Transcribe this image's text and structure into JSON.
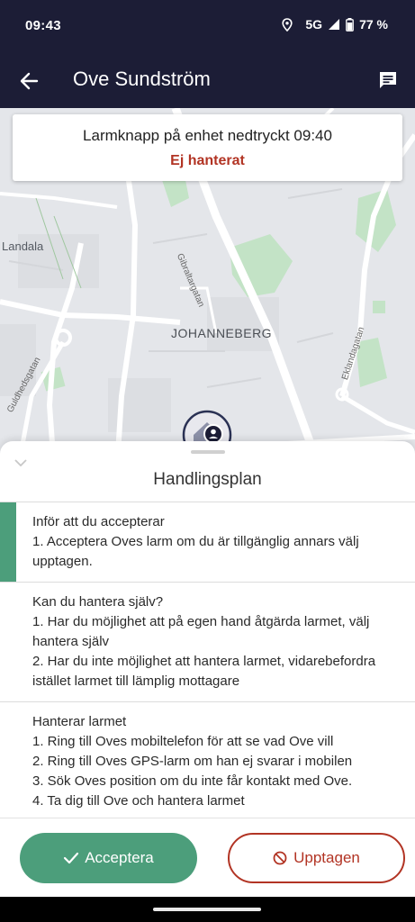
{
  "status_bar": {
    "time": "09:43",
    "network": "5G",
    "battery": "77 %",
    "icons": [
      "location-icon",
      "signal-icon",
      "battery-icon"
    ]
  },
  "app_bar": {
    "title": "Ove Sundström",
    "back_icon": "arrow-left-icon",
    "action_icon": "chat-icon"
  },
  "map": {
    "labels": {
      "district": "JOHANNEBERG",
      "area_left": "Landala",
      "street_gibraltar": "Gibraltargatan",
      "street_eklanda": "Eklandagatan",
      "street_guldheds": "Guldhedsgatan"
    }
  },
  "alarm": {
    "title": "Larmknapp på enhet nedtryckt 09:40",
    "status": "Ej hanterat",
    "status_color": "#b23424"
  },
  "sheet": {
    "title": "Handlingsplan",
    "collapse_icon": "chevron-down-icon",
    "items": [
      {
        "heading": "Inför att du accepterar",
        "lines": [
          "1. Acceptera Oves larm om du är tillgänglig annars välj upptagen."
        ]
      },
      {
        "heading": "Kan du hantera själv?",
        "lines": [
          "1. Har du möjlighet att på egen hand åtgärda larmet, välj hantera själv",
          "2. Har du inte möjlighet att hantera larmet, vidarebefordra istället larmet till lämplig mottagare"
        ]
      },
      {
        "heading": "Hanterar larmet",
        "lines": [
          "1. Ring till Oves mobiltelefon för att se vad Ove vill",
          "2. Ring till Oves GPS-larm om han ej svarar i mobilen",
          "3. Sök Oves position om du inte får kontakt med Ove.",
          "4. Ta dig till Ove och hantera larmet"
        ]
      }
    ]
  },
  "actions": {
    "accept_label": "Acceptera",
    "busy_label": "Upptagen",
    "accept_color": "#4c9e7b",
    "busy_color": "#b23424"
  }
}
